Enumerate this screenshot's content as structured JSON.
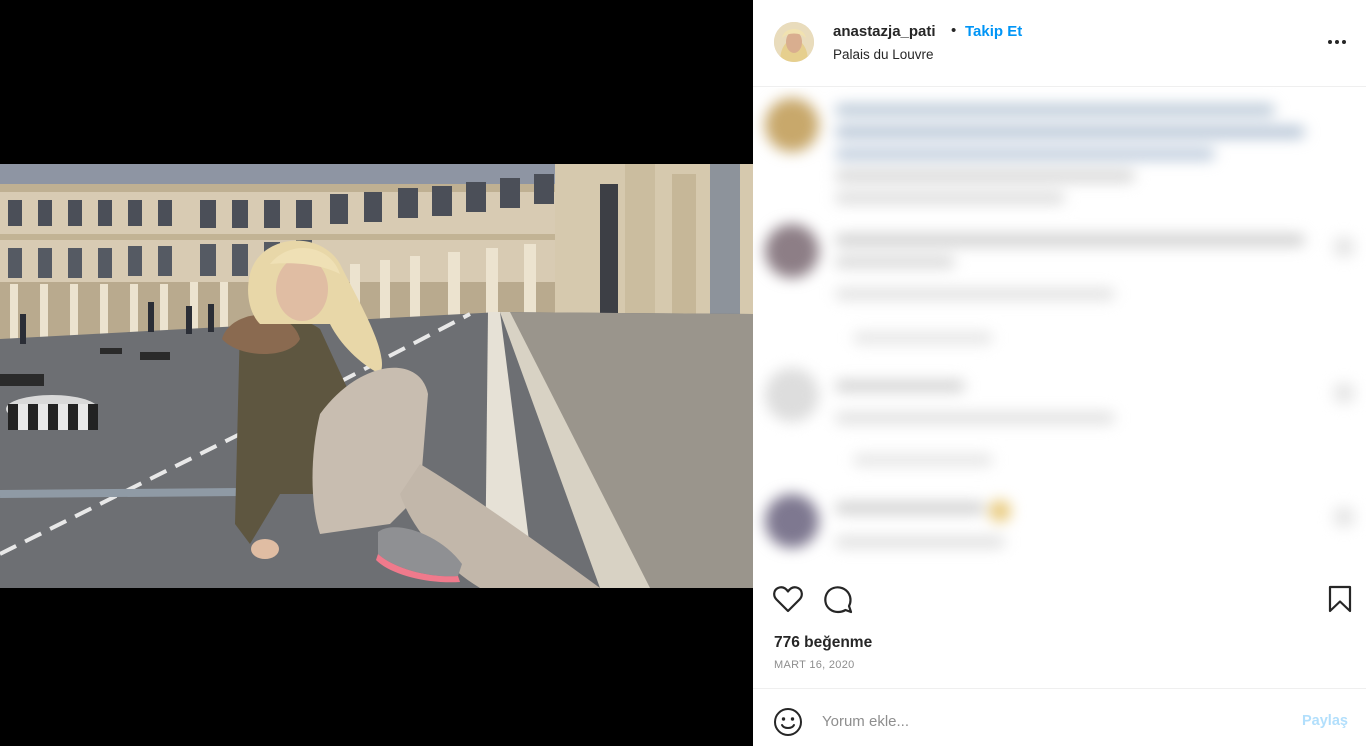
{
  "post": {
    "username": "anastazja_pati",
    "separator": "•",
    "follow_label": "Takip Et",
    "location": "Palais du Louvre",
    "more_icon": "ellipsis-icon",
    "likes": "776 beğenme",
    "date": "MART 16, 2020"
  },
  "actions": {
    "like_icon": "heart-icon",
    "comment_icon": "comment-bubble-icon",
    "save_icon": "bookmark-icon"
  },
  "comment_box": {
    "placeholder": "Yorum ekle...",
    "post_label": "Paylaş",
    "emoji_icon": "smiley-icon"
  },
  "colors": {
    "accent": "#0095f6",
    "post_disabled": "#b2dffc",
    "text": "#262626",
    "muted": "#8e8e8e"
  }
}
